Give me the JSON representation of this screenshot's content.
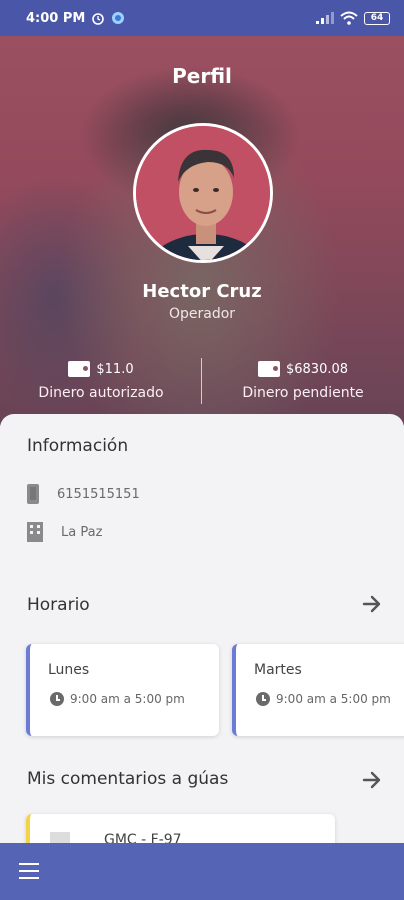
{
  "status_bar": {
    "time": "4:00 PM",
    "battery": "64"
  },
  "header": {
    "title": "Perfil"
  },
  "profile": {
    "name": "Hector Cruz",
    "role": "Operador"
  },
  "balances": [
    {
      "value": "$11.0",
      "label": "Dinero autorizado"
    },
    {
      "value": "$6830.08",
      "label": "Dinero pendiente"
    }
  ],
  "info": {
    "title": "Información",
    "phone": "6151515151",
    "city": "La Paz"
  },
  "schedule": {
    "title": "Horario",
    "days": [
      {
        "day": "Lunes",
        "hours": "9:00 am a 5:00 pm"
      },
      {
        "day": "Martes",
        "hours": "9:00 am a 5:00 pm"
      }
    ]
  },
  "comments": {
    "title": "Mis comentarios a gúas",
    "items": [
      {
        "title": "GMC - F-97"
      }
    ]
  },
  "colors": {
    "primary": "#5564b4",
    "status": "#4a56a8",
    "card_accent": "#6c7bd4",
    "comment_accent": "#f2d34a"
  }
}
